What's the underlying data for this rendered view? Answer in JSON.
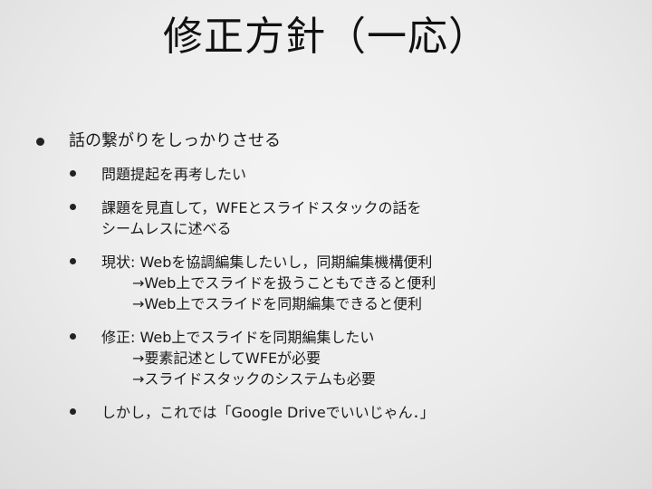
{
  "title": "修正方針（一応）",
  "items": [
    {
      "level": 1,
      "lines": [
        "話の繋がりをしっかりさせる"
      ]
    },
    {
      "level": 2,
      "lines": [
        "問題提起を再考したい"
      ]
    },
    {
      "level": 2,
      "lines": [
        "課題を見直して，WFEとスライドスタックの話を",
        "シームレスに述べる"
      ]
    },
    {
      "level": 2,
      "lines": [
        "現状: Webを協調編集したいし，同期編集機構便利",
        "→Web上でスライドを扱うこともできると便利",
        "→Web上でスライドを同期編集できると便利"
      ]
    },
    {
      "level": 2,
      "lines": [
        "修正: Web上でスライドを同期編集したい",
        "→要素記述としてWFEが必要",
        "→スライドスタックのシステムも必要"
      ]
    },
    {
      "level": 2,
      "lines": [
        "しかし，これでは「Google Driveでいいじゃん．」"
      ]
    }
  ]
}
